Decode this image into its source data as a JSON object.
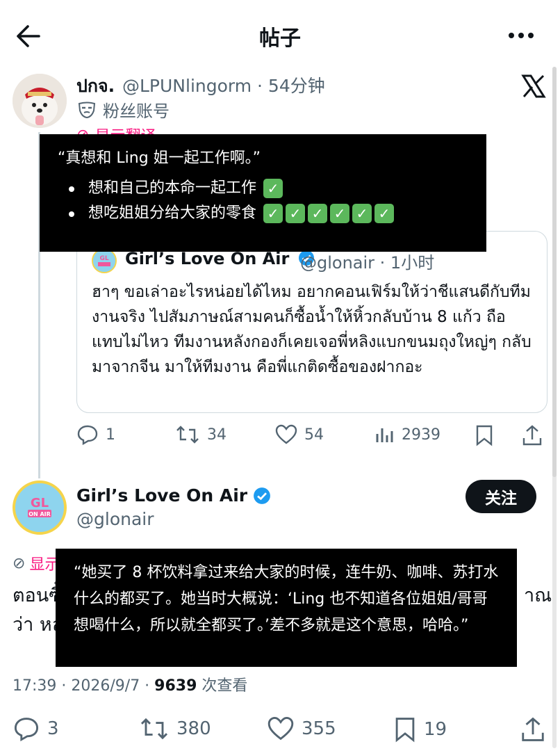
{
  "header": {
    "title": "帖子",
    "back_icon": "arrow-left-icon",
    "more_icon": "more-horizontal-icon"
  },
  "tweet1": {
    "name": "ปกจ.",
    "handle": "@LPUNlingorm · 54分钟",
    "fan_label": "粉丝账号",
    "translate_label": "显示翻译",
    "overlay": {
      "quote": "“真想和 Ling 姐一起工作啊。”",
      "items": [
        "想和自己的本命一起工作",
        "想吃姐姐分给大家的零食"
      ]
    },
    "quoted": {
      "name": "Girl’s Love On Air",
      "handle": "@glonair · 1小时",
      "text": "ฮาๆ ขอเล่าอะไรหน่อยได้ไหม อยากคอนเฟิร์มให้ว่าชีแสนดีกับทีมงานจริง ไปสัมภาษณ์สามคนก็ซื้อน้ำให้หิ้วกลับบ้าน 8 แก้ว ถือแทบไม่ไหว ทีมงานหลังกองก็เคยเจอพี่หลิงแบกขนมถุงใหญ่ๆ กลับมาจากจีน มาให้ทีมงาน คือพี่แกติดซื้อของฝากอะ"
    },
    "actions": {
      "replies": "1",
      "retweets": "34",
      "likes": "54",
      "views": "2939"
    }
  },
  "tweet2": {
    "name": "Girl’s Love On Air",
    "handle": "@glonair",
    "follow_label": "关注",
    "translate_label": "显示",
    "body_line1": "ตอนซื้",
    "body_line2": "ว่า หล",
    "body_tail": "าณ",
    "overlay_text": "“她买了 8 杯饮料拿过来给大家的时候，连牛奶、咖啡、苏打水什么的都买了。她当时大概说：‘Ling 也不知道各位姐姐/哥哥想喝什么，所以就全都买了。’差不多就是这个意思，哈哈。”",
    "time": "17:39 · 2026/9/7 · ",
    "views_count": "9639",
    "views_label": " 次查看",
    "actions": {
      "replies": "3",
      "retweets": "380",
      "likes": "355",
      "bookmarks": "19"
    }
  },
  "colors": {
    "accent_pink": "#f91880",
    "verified_blue": "#1d9bf0",
    "text_gray": "#536471",
    "check_green": "#5cb85c"
  }
}
